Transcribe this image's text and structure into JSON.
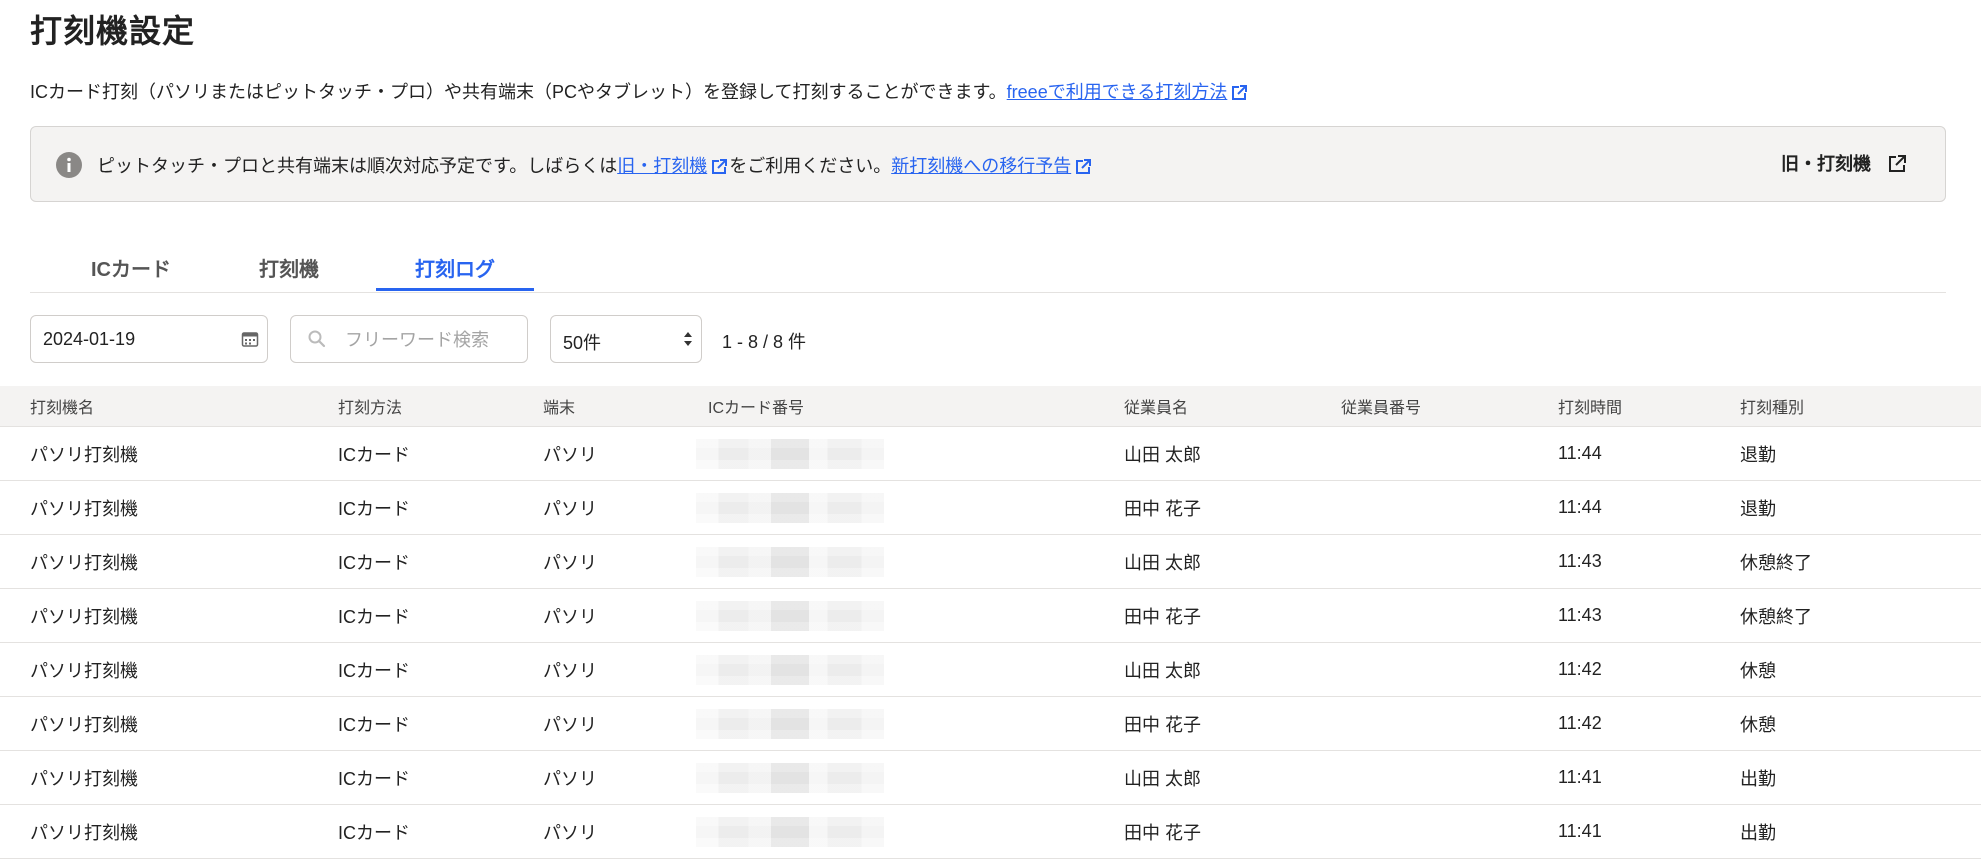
{
  "page": {
    "title": "打刻機設定",
    "description": "ICカード打刻（パソリまたはピットタッチ・プロ）や共有端末（PCやタブレット）を登録して打刻することができます。",
    "description_link": "freeeで利用できる打刻方法"
  },
  "notice": {
    "text_1": "ピットタッチ・プロと共有端末は順次対応予定です。しばらくは",
    "link_old": "旧・打刻機",
    "text_2": "をご利用ください。",
    "link_migration": "新打刻機への移行予告",
    "button_label": "旧・打刻機"
  },
  "tabs": [
    {
      "label": "ICカード",
      "active": false
    },
    {
      "label": "打刻機",
      "active": false
    },
    {
      "label": "打刻ログ",
      "active": true
    }
  ],
  "filters": {
    "date": "2024-01-19",
    "search_placeholder": "フリーワード検索",
    "per_page": "50件",
    "count": "1 - 8 / 8  件"
  },
  "table": {
    "columns": [
      "打刻機名",
      "打刻方法",
      "端末",
      "ICカード番号",
      "従業員名",
      "従業員番号",
      "打刻時間",
      "打刻種別"
    ],
    "rows": [
      [
        "パソリ打刻機",
        "ICカード",
        "パソリ",
        "",
        "山田 太郎",
        "",
        "11:44",
        "退勤"
      ],
      [
        "パソリ打刻機",
        "ICカード",
        "パソリ",
        "",
        "田中 花子",
        "",
        "11:44",
        "退勤"
      ],
      [
        "パソリ打刻機",
        "ICカード",
        "パソリ",
        "",
        "山田 太郎",
        "",
        "11:43",
        "休憩終了"
      ],
      [
        "パソリ打刻機",
        "ICカード",
        "パソリ",
        "",
        "田中 花子",
        "",
        "11:43",
        "休憩終了"
      ],
      [
        "パソリ打刻機",
        "ICカード",
        "パソリ",
        "",
        "山田 太郎",
        "",
        "11:42",
        "休憩"
      ],
      [
        "パソリ打刻機",
        "ICカード",
        "パソリ",
        "",
        "田中 花子",
        "",
        "11:42",
        "休憩"
      ],
      [
        "パソリ打刻機",
        "ICカード",
        "パソリ",
        "",
        "山田 太郎",
        "",
        "11:41",
        "出勤"
      ],
      [
        "パソリ打刻機",
        "ICカード",
        "パソリ",
        "",
        "田中 花子",
        "",
        "11:41",
        "出勤"
      ]
    ]
  },
  "icons": {
    "info": "info-icon",
    "external": "external-link-icon",
    "calendar": "calendar-icon",
    "search": "search-icon",
    "select": "select-arrows-icon"
  },
  "colors": {
    "link": "#2864f0",
    "active_tab": "#2864f0",
    "notice_bg": "#f4f3f2",
    "header_bg": "#f4f3f2"
  }
}
